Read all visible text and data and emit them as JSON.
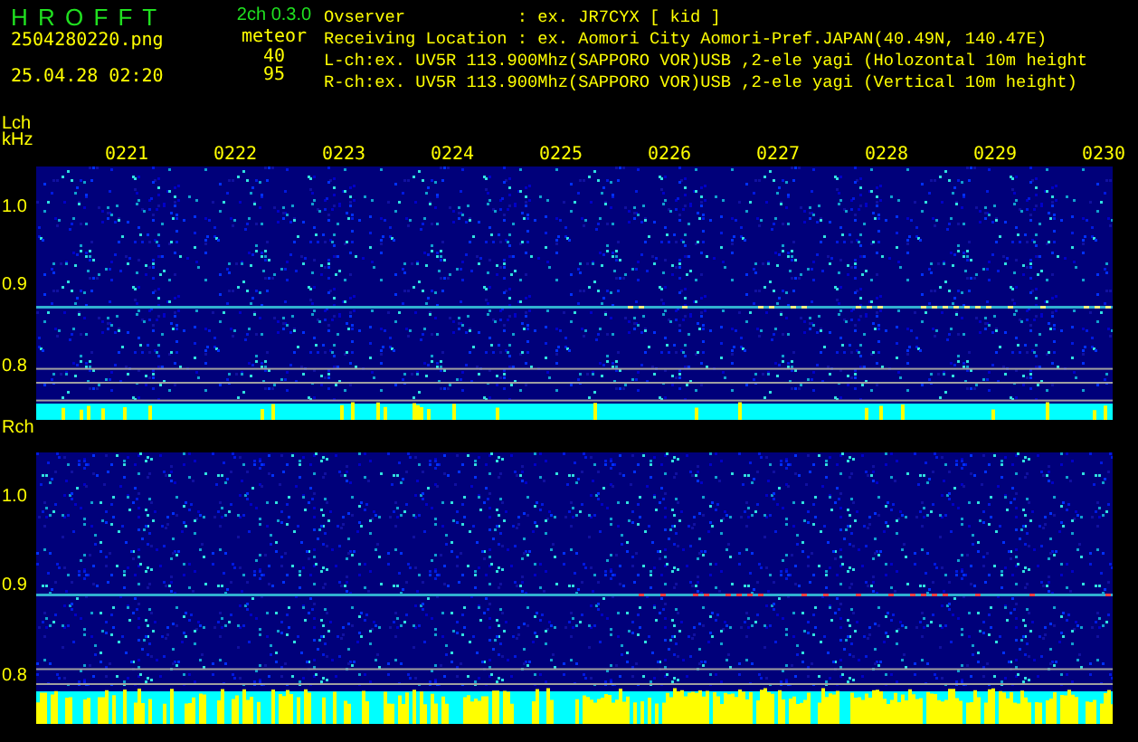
{
  "header": {
    "title": "H R O F F T",
    "version": "2ch 0.3.0",
    "filename": "2504280220.png",
    "datetime": "25.04.28 02:20",
    "meteor_label": "meteor",
    "counts": [
      "40",
      "95"
    ],
    "info_lines": [
      "Ovserver           : ex. JR7CYX [ kid ]",
      "Receiving Location : ex. Aomori City Aomori-Pref.JAPAN(40.49N, 140.47E)",
      "L-ch:ex. UV5R 113.900Mhz(SAPPORO VOR)USB ,2-ele yagi (Holozontal 10m height",
      "R-ch:ex. UV5R 113.900Mhz(SAPPORO VOR)USB ,2-ele yagi (Vertical 10m height)"
    ]
  },
  "panels": [
    {
      "channel": "Lch",
      "unit": "kHz",
      "time_labels": [
        "0221",
        "0222",
        "0223",
        "0224",
        "0225",
        "0226",
        "0227",
        "0228",
        "0229",
        "0230"
      ],
      "freq_labels": [
        "1.0",
        "0.9",
        "0.8"
      ]
    },
    {
      "channel": "Rch",
      "freq_labels": [
        "1.0",
        "0.9",
        "0.8"
      ]
    }
  ]
}
